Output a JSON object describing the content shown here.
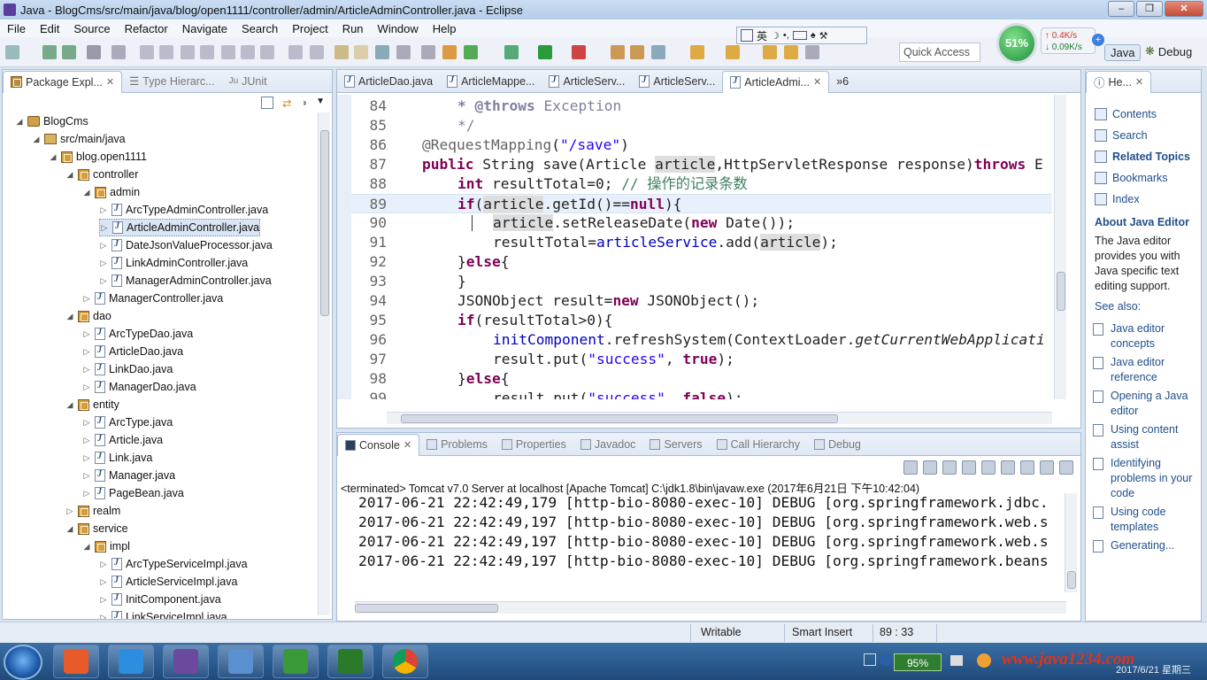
{
  "window": {
    "title": "Java - BlogCms/src/main/java/blog/open1111/controller/admin/ArticleAdminController.java - Eclipse",
    "minimize": "–",
    "maximize": "❒",
    "close": "✕"
  },
  "menu": [
    "File",
    "Edit",
    "Source",
    "Refactor",
    "Navigate",
    "Search",
    "Project",
    "Run",
    "Window",
    "Help"
  ],
  "ime": {
    "label": "英"
  },
  "quick_access": {
    "placeholder": "Quick Access"
  },
  "net": {
    "cpu": "51%",
    "up": "↑ 0.4K/s",
    "down": "↓ 0.09K/s",
    "plus": "+"
  },
  "perspectives": {
    "java": "Java",
    "debug": "Debug"
  },
  "package_explorer": {
    "tabs": [
      "Package Expl...",
      "Type Hierarc...",
      "JUnit"
    ],
    "tree": [
      {
        "label": "BlogCms",
        "icon": "project-icon",
        "depth": 0,
        "arrow": "◢"
      },
      {
        "label": "src/main/java",
        "icon": "source-folder-icon",
        "depth": 1,
        "arrow": "◢"
      },
      {
        "label": "blog.open1111",
        "icon": "package-icon",
        "depth": 2,
        "arrow": "◢"
      },
      {
        "label": "controller",
        "icon": "package-icon",
        "depth": 3,
        "arrow": "◢"
      },
      {
        "label": "admin",
        "icon": "package-icon",
        "depth": 4,
        "arrow": "◢"
      },
      {
        "label": "ArcTypeAdminController.java",
        "icon": "java-file-icon",
        "depth": 5,
        "arrow": "▷"
      },
      {
        "label": "ArticleAdminController.java",
        "icon": "java-file-icon",
        "depth": 5,
        "arrow": "▷",
        "selected": true
      },
      {
        "label": "DateJsonValueProcessor.java",
        "icon": "java-file-icon",
        "depth": 5,
        "arrow": "▷"
      },
      {
        "label": "LinkAdminController.java",
        "icon": "java-file-icon",
        "depth": 5,
        "arrow": "▷"
      },
      {
        "label": "ManagerAdminController.java",
        "icon": "java-file-icon",
        "depth": 5,
        "arrow": "▷"
      },
      {
        "label": "ManagerController.java",
        "icon": "java-file-icon",
        "depth": 4,
        "arrow": "▷"
      },
      {
        "label": "dao",
        "icon": "package-icon",
        "depth": 3,
        "arrow": "◢"
      },
      {
        "label": "ArcTypeDao.java",
        "icon": "java-file-icon",
        "depth": 4,
        "arrow": "▷"
      },
      {
        "label": "ArticleDao.java",
        "icon": "java-file-icon",
        "depth": 4,
        "arrow": "▷"
      },
      {
        "label": "LinkDao.java",
        "icon": "java-file-icon",
        "depth": 4,
        "arrow": "▷"
      },
      {
        "label": "ManagerDao.java",
        "icon": "java-file-icon",
        "depth": 4,
        "arrow": "▷"
      },
      {
        "label": "entity",
        "icon": "package-icon",
        "depth": 3,
        "arrow": "◢"
      },
      {
        "label": "ArcType.java",
        "icon": "java-file-icon",
        "depth": 4,
        "arrow": "▷"
      },
      {
        "label": "Article.java",
        "icon": "java-file-icon",
        "depth": 4,
        "arrow": "▷"
      },
      {
        "label": "Link.java",
        "icon": "java-file-icon",
        "depth": 4,
        "arrow": "▷"
      },
      {
        "label": "Manager.java",
        "icon": "java-file-icon",
        "depth": 4,
        "arrow": "▷"
      },
      {
        "label": "PageBean.java",
        "icon": "java-file-icon",
        "depth": 4,
        "arrow": "▷"
      },
      {
        "label": "realm",
        "icon": "package-icon",
        "depth": 3,
        "arrow": "▷"
      },
      {
        "label": "service",
        "icon": "package-icon",
        "depth": 3,
        "arrow": "◢"
      },
      {
        "label": "impl",
        "icon": "package-icon",
        "depth": 4,
        "arrow": "◢"
      },
      {
        "label": "ArcTypeServiceImpl.java",
        "icon": "java-file-icon",
        "depth": 5,
        "arrow": "▷"
      },
      {
        "label": "ArticleServiceImpl.java",
        "icon": "java-file-icon",
        "depth": 5,
        "arrow": "▷"
      },
      {
        "label": "InitComponent.java",
        "icon": "java-file-icon",
        "depth": 5,
        "arrow": "▷"
      },
      {
        "label": "LinkServiceImpl.java",
        "icon": "java-file-icon",
        "depth": 5,
        "arrow": "▷"
      }
    ]
  },
  "editor": {
    "tabs": [
      {
        "label": "ArticleDao.java"
      },
      {
        "label": "ArticleMappe..."
      },
      {
        "label": "ArticleServ..."
      },
      {
        "label": "ArticleServ..."
      },
      {
        "label": "ArticleAdmi...",
        "active": true
      }
    ],
    "overflow": "»6",
    "current_line": 89,
    "lines": [
      {
        "n": "84",
        "html": "<span class='jd'>* </span><span class='jd'>@throws</span><span class='jd' style='font-weight:normal'> Exception</span>",
        "indent": 1
      },
      {
        "n": "85",
        "html": "<span class='jd' style='font-weight:normal'>*/</span>",
        "indent": 1
      },
      {
        "n": "86",
        "html": "<span class='ann'>@RequestMapping</span>(<span class='str'>\"/save\"</span>)",
        "indent": 0
      },
      {
        "n": "87",
        "html": "<span class='kw'>public</span> String save(Article <span class='hl'>article</span>,HttpServletResponse response)<span class='kw'>throws</span> E",
        "indent": 0
      },
      {
        "n": "88",
        "html": "<span class='kw'>int</span> resultTotal=0; <span class='com'>// 操作的记录条数</span>",
        "indent": 1
      },
      {
        "n": "89",
        "html": "<span class='kw'>if</span>(<span class='hl'>article</span>.getId()==<span class='kw'>null</span>){",
        "indent": 1
      },
      {
        "n": "90",
        "html": "<span class='hl'>article</span>.setReleaseDate(<span class='kw'>new</span> Date());",
        "indent": 2
      },
      {
        "n": "91",
        "html": "resultTotal=<span class='fld'>articleService</span>.add(<span class='hl'>article</span>);",
        "indent": 2
      },
      {
        "n": "92",
        "html": "}<span class='kw'>else</span>{",
        "indent": 1
      },
      {
        "n": "93",
        "html": "}",
        "indent": 1
      },
      {
        "n": "94",
        "html": "JSONObject result=<span class='kw'>new</span> JSONObject();",
        "indent": 1
      },
      {
        "n": "95",
        "html": "<span class='kw'>if</span>(resultTotal>0){",
        "indent": 1
      },
      {
        "n": "96",
        "html": "<span class='fld'>initComponent</span>.refreshSystem(ContextLoader.<span class='it'>getCurrentWebApplicati</span>",
        "indent": 2
      },
      {
        "n": "97",
        "html": "result.put(<span class='str'>\"success\"</span>, <span class='kw'>true</span>);",
        "indent": 2
      },
      {
        "n": "98",
        "html": "}<span class='kw'>else</span>{",
        "indent": 1
      },
      {
        "n": "99",
        "html": "result.put(<span class='str'>\"success\"</span>, <span class='kw'>false</span>);",
        "indent": 2
      }
    ]
  },
  "console": {
    "tabs": [
      "Console",
      "Problems",
      "Properties",
      "Javadoc",
      "Servers",
      "Call Hierarchy",
      "Debug"
    ],
    "terminated": "<terminated> Tomcat v7.0 Server at localhost [Apache Tomcat] C:\\jdk1.8\\bin\\javaw.exe (2017年6月21日 下午10:42:04)",
    "lines": [
      "2017-06-21 22:42:49,179 [http-bio-8080-exec-10] DEBUG [org.springframework.jdbc.",
      "2017-06-21 22:42:49,197 [http-bio-8080-exec-10] DEBUG [org.springframework.web.s",
      "2017-06-21 22:42:49,197 [http-bio-8080-exec-10] DEBUG [org.springframework.web.s",
      "2017-06-21 22:42:49,197 [http-bio-8080-exec-10] DEBUG [org.springframework.beans"
    ]
  },
  "help": {
    "tab": "He...",
    "links": [
      "Contents",
      "Search",
      "Related Topics",
      "Bookmarks",
      "Index"
    ],
    "about_title": "About Java Editor",
    "about_text": "The Java editor provides you with Java specific text editing support.",
    "see_also": "See also:",
    "items": [
      "Java editor concepts",
      "Java editor reference",
      "Opening a Java editor",
      "Using content assist",
      "Identifying problems in your code",
      "Using code templates",
      "Generating..."
    ]
  },
  "status": {
    "writable": "Writable",
    "insert": "Smart Insert",
    "position": "89 : 33"
  },
  "taskbar": {
    "battery": "95%",
    "watermark": "www.java1234.com",
    "clock": "2017/6/21 星期三",
    "apps": [
      "windows-media-icon",
      "wps-writer-icon",
      "java-ee-icon",
      "dolphin-icon",
      "camtasia-recorder-icon",
      "camtasia-studio-icon",
      "chrome-icon"
    ]
  }
}
